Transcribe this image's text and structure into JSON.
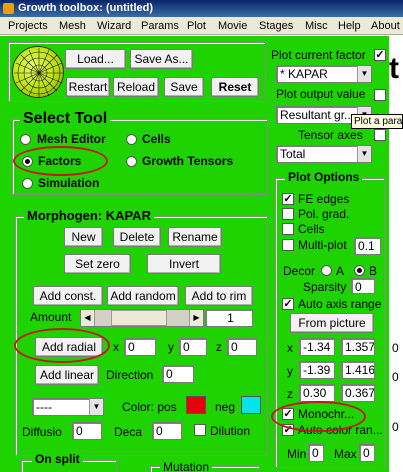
{
  "window": {
    "title": "Growth toolbox: (untitled)"
  },
  "menu": [
    "Projects",
    "Mesh",
    "Wizard",
    "Params",
    "Plot",
    "Movie",
    "Stages",
    "Misc",
    "Help",
    "About"
  ],
  "top_buttons": {
    "load": "Load...",
    "save_as": "Save As...",
    "restart": "Restart",
    "reload": "Reload",
    "save": "Save",
    "reset": "Reset"
  },
  "select_tool": {
    "title": "Select Tool",
    "options": {
      "mesh_editor": "Mesh Editor",
      "cells": "Cells",
      "factors": "Factors",
      "growth_tensors": "Growth Tensors",
      "simulation": "Simulation"
    },
    "selected": "Factors"
  },
  "morphogen": {
    "title": "Morphogen: KAPAR",
    "new": "New",
    "delete": "Delete",
    "rename": "Rename",
    "set_zero": "Set zero",
    "invert": "Invert",
    "add_const": "Add const.",
    "add_random": "Add random",
    "add_to_rim": "Add to rim",
    "amount_label": "Amount",
    "amount_value": "1",
    "add_radial": "Add radial",
    "x_label": "x",
    "x_value": "0",
    "y_label": "y",
    "y_value": "0",
    "z_label": "z",
    "z_value": "0",
    "add_linear": "Add linear",
    "direction_label": "Direction",
    "direction_value": "0",
    "combo_value": "----",
    "color_label": "Color: pos",
    "neg_label": "neg",
    "pos_color": "#e8000b",
    "neg_color": "#00e5e8",
    "diffusio_label": "Diffusio",
    "diffusio_value": "0",
    "deca_label": "Deca",
    "deca_value": "0",
    "dilution_label": "Dilution",
    "on_split_label": "On split",
    "mutation_label": "Mutation"
  },
  "plot_panel": {
    "plot_current_factor_label": "Plot current factor",
    "plot_current_factor_checked": true,
    "factor_value": "* KAPAR",
    "plot_output_value_label": "Plot output value",
    "output_combo_value": "Resultant gr...",
    "tooltip": "Plot a para",
    "tensor_axes_label": "Tensor axes",
    "total_value": "Total"
  },
  "plot_options": {
    "title": "Plot Options",
    "fe_edges": "FE edges",
    "pol_grad": "Pol. grad.",
    "cells": "Cells",
    "multi_plot": "Multi-plot",
    "multi_plot_value": "0.1",
    "decor_label": "Decor",
    "decor_a": "A",
    "decor_b": "B",
    "sparsity_label": "Sparsity",
    "sparsity_value": "0",
    "auto_axis_range": "Auto axis range",
    "from_picture": "From picture",
    "x_label": "x",
    "x_min": "-1.34",
    "x_max": "1.357",
    "y_label": "y",
    "y_min": "-1.39",
    "y_max": "1.416",
    "z_label": "z",
    "z_min": "0.30",
    "z_max": "0.367",
    "monochrome": "Monochr...",
    "auto_color_range": "Auto color ran...",
    "min_label": "Min",
    "min_value": "0",
    "max_label": "Max",
    "max_value": "0"
  },
  "canvas": {
    "partial_glyph": "t",
    "edge_digits": [
      "0",
      "0",
      "0"
    ]
  },
  "colors": {
    "panel_green": "#1fd300",
    "highlight_ring": "#c11a1a"
  }
}
